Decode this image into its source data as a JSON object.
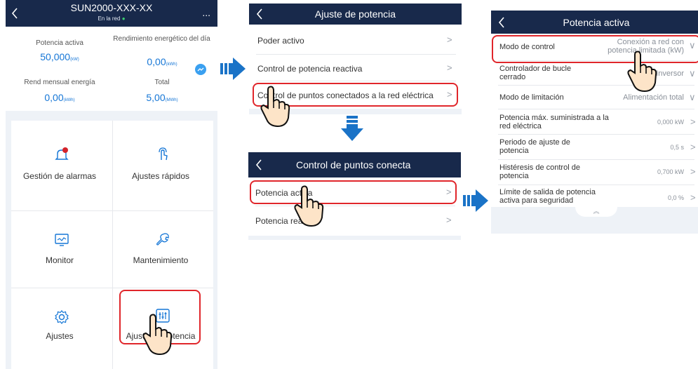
{
  "screen1": {
    "title": "SUN2000-XXX-XX",
    "status": "En la red",
    "menu": "...",
    "stats": [
      {
        "label": "Potencia activa",
        "value": "50,000",
        "unit": "(kW)"
      },
      {
        "label": "Rendimiento energético del día",
        "value": "0,00",
        "unit": "(kWh)"
      },
      {
        "label": "Rend mensual energía",
        "value": "0,00",
        "unit": "(kWh)"
      },
      {
        "label": "Total",
        "value": "5,00",
        "unit": "(MWh)"
      }
    ],
    "tiles": [
      "Gestión de alarmas",
      "Ajustes rápidos",
      "Monitor",
      "Mantenimiento",
      "Ajustes",
      "Ajuste de potencia"
    ]
  },
  "screen2": {
    "title": "Ajuste de potencia",
    "items": [
      "Poder activo",
      "Control de potencia reactiva",
      "Control de puntos conectados a la red eléctrica"
    ]
  },
  "screen3": {
    "title": "Control de puntos conecta",
    "items": [
      "Potencia activa",
      "Potencia rea"
    ]
  },
  "screen4": {
    "title": "Potencia activa",
    "rows": [
      {
        "label": "Modo de control",
        "value": "Conexión a red con potencia limitada (kW)"
      },
      {
        "label": "Controlador de bucle cerrado",
        "value": "Inversor"
      },
      {
        "label": "Modo de limitación",
        "value": "Alimentación total"
      },
      {
        "label": "Potencia máx. suministrada a la red eléctrica",
        "value": "0,000 kW"
      },
      {
        "label": "Periodo de ajuste de potencia",
        "value": "0,5 s"
      },
      {
        "label": "Histéresis de control de potencia",
        "value": "0,700 kW"
      },
      {
        "label": "Límite de salida de potencia activa para seguridad",
        "value": "0,0 %"
      }
    ]
  },
  "colors": {
    "header": "#18294b",
    "accent": "#1576d6",
    "highlight": "#e0262b",
    "arrow": "#1a73c7"
  }
}
